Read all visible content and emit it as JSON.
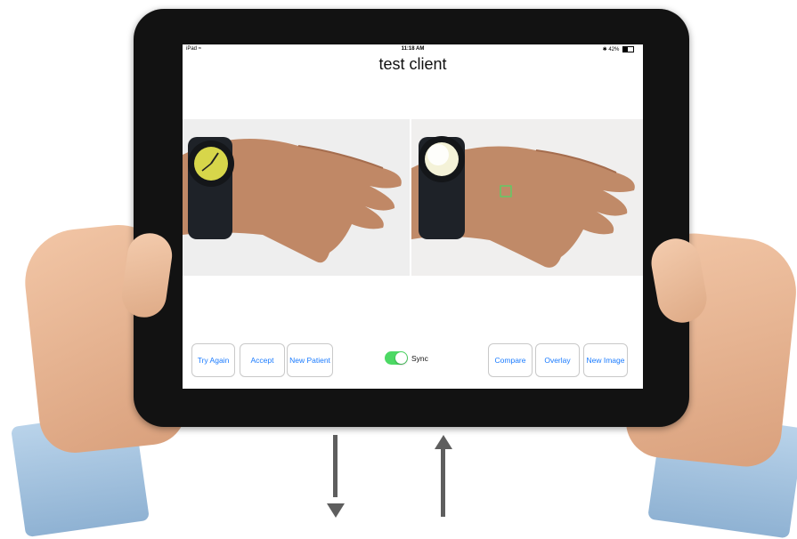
{
  "status_bar": {
    "device": "iPad",
    "wifi_icon": "wifi-icon",
    "time": "11:18 AM",
    "bluetooth_icon": "bluetooth-icon",
    "battery": "42%",
    "battery_icon": "battery-icon",
    "battery_level": 0.42
  },
  "app": {
    "title": "test client"
  },
  "images": {
    "left": {
      "icon": "hand-with-watch-photo"
    },
    "right": {
      "icon": "hand-with-watch-photo",
      "marker_icon": "selection-marker-icon",
      "marker_color": "#4cd964"
    }
  },
  "buttons": {
    "try_again": "Try Again",
    "accept": "Accept",
    "new_patient": "New Patient",
    "compare": "Compare",
    "overlay": "Overlay",
    "new_image": "New Image"
  },
  "sync": {
    "label": "Sync",
    "on": true,
    "color": "#4cd964"
  },
  "colors": {
    "accent": "#1a7bff",
    "bezel": "#121212",
    "arrow": "#5e5e5e"
  },
  "decor": {
    "arrows": [
      "arrow-down-icon",
      "arrow-up-icon"
    ]
  }
}
